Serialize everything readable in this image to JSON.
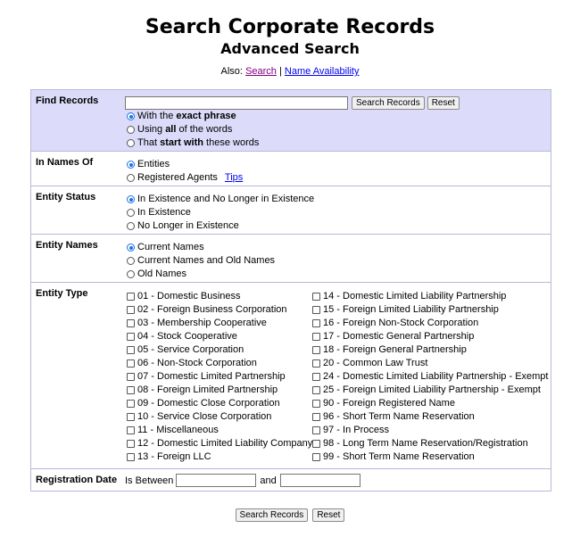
{
  "header": {
    "title": "Search Corporate Records",
    "subtitle": "Advanced Search",
    "also_label": "Also:",
    "also_search": "Search",
    "also_sep": "|",
    "also_name_availability": "Name Availability"
  },
  "find_records": {
    "label": "Find Records",
    "search_value": "",
    "search_button": "Search Records",
    "reset_button": "Reset",
    "options": [
      {
        "pre": "With the ",
        "bold": "exact phrase",
        "post": "",
        "selected": true
      },
      {
        "pre": "Using ",
        "bold": "all",
        "post": " of the words",
        "selected": false
      },
      {
        "pre": "That ",
        "bold": "start with",
        "post": " these words",
        "selected": false
      }
    ]
  },
  "in_names_of": {
    "label": "In Names Of",
    "options": [
      {
        "label": "Entities",
        "selected": true
      },
      {
        "label": "Registered Agents",
        "selected": false
      }
    ],
    "tips_link": "Tips"
  },
  "entity_status": {
    "label": "Entity Status",
    "options": [
      {
        "label": "In Existence and No Longer in Existence",
        "selected": true
      },
      {
        "label": "In Existence",
        "selected": false
      },
      {
        "label": "No Longer in Existence",
        "selected": false
      }
    ]
  },
  "entity_names": {
    "label": "Entity Names",
    "options": [
      {
        "label": "Current Names",
        "selected": true
      },
      {
        "label": "Current Names and Old Names",
        "selected": false
      },
      {
        "label": "Old Names",
        "selected": false
      }
    ]
  },
  "entity_type": {
    "label": "Entity Type",
    "left": [
      "01 - Domestic Business",
      "02 - Foreign Business Corporation",
      "03 - Membership Cooperative",
      "04 - Stock Cooperative",
      "05 - Service Corporation",
      "06 - Non-Stock Corporation",
      "07 - Domestic Limited Partnership",
      "08 - Foreign Limited Partnership",
      "09 - Domestic Close Corporation",
      "10 - Service Close Corporation",
      "11 - Miscellaneous",
      "12 - Domestic Limited Liability Company",
      "13 - Foreign LLC"
    ],
    "right": [
      "14 - Domestic Limited Liability Partnership",
      "15 - Foreign Limited Liability Partnership",
      "16 - Foreign Non-Stock Corporation",
      "17 - Domestic General Partnership",
      "18 - Foreign General Partnership",
      "20 - Common Law Trust",
      "24 - Domestic Limited Liability Partnership - Exempt",
      "25 - Foreign Limited Liability Partnership - Exempt",
      "90 - Foreign Registered Name",
      "96 - Short Term Name Reservation",
      "97 - In Process",
      "98 - Long Term Name Reservation/Registration",
      "99 - Short Term Name Reservation"
    ]
  },
  "registration_date": {
    "label": "Registration Date",
    "is_between": "Is Between",
    "and": "and",
    "from_value": "",
    "to_value": ""
  },
  "footer": {
    "search_button": "Search Records",
    "reset_button": "Reset"
  }
}
